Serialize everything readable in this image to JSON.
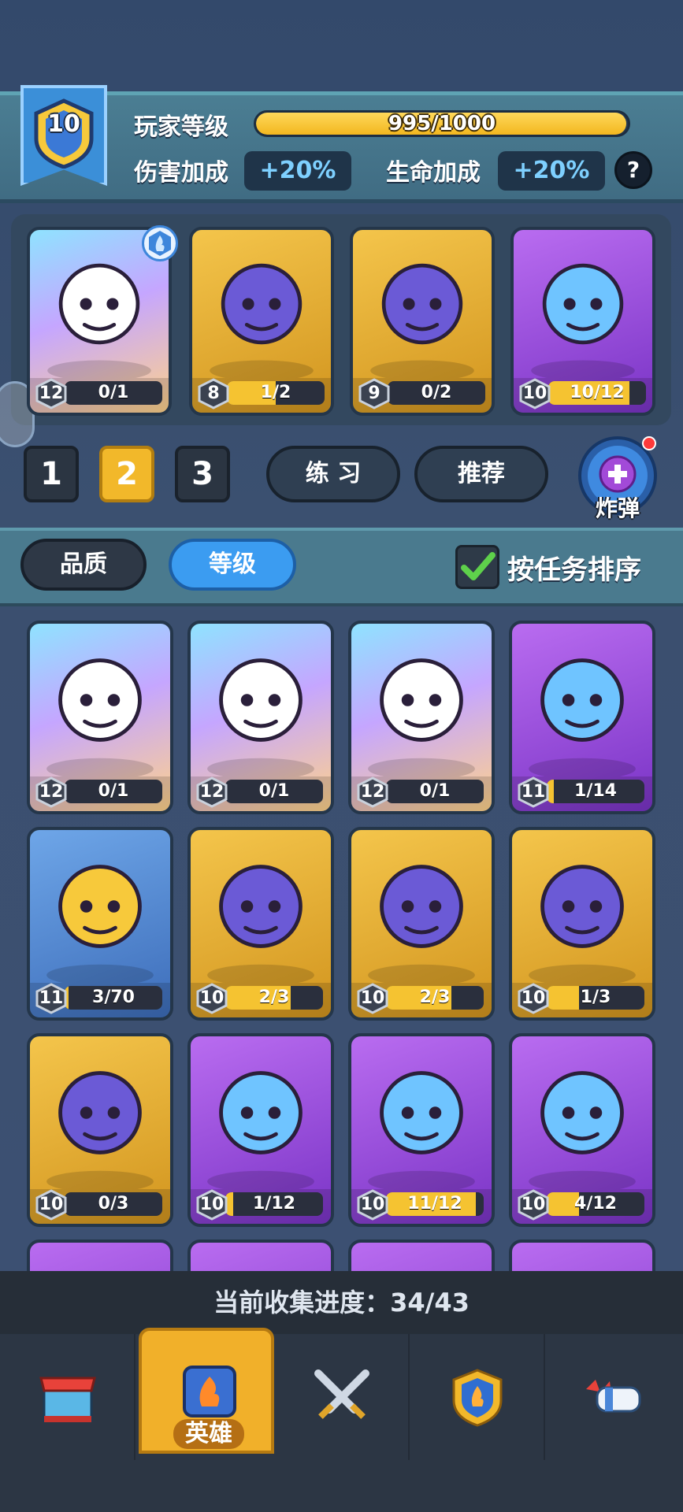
{
  "player": {
    "level": "10",
    "level_label": "玩家等级",
    "xp_text": "995/1000",
    "xp_fraction": 0.995,
    "damage_label": "伤害加成",
    "damage_value": "+20%",
    "health_label": "生命加成",
    "health_value": "+20%",
    "help": "?"
  },
  "deck": {
    "cards": [
      {
        "level": "12",
        "progress": "0/1",
        "fill": 0,
        "rarity": "legend",
        "icon": "demon-hero-icon"
      },
      {
        "level": "8",
        "progress": "1/2",
        "fill": 0.5,
        "rarity": "gold",
        "icon": "ice-golem-icon"
      },
      {
        "level": "9",
        "progress": "0/2",
        "fill": 0,
        "rarity": "gold",
        "icon": "spider-icon"
      },
      {
        "level": "10",
        "progress": "10/12",
        "fill": 0.83,
        "rarity": "purple",
        "icon": "ice-princess-icon"
      }
    ],
    "slots": [
      "1",
      "2",
      "3"
    ],
    "active_slot": "2",
    "practice": "练 习",
    "recommend": "推荐",
    "bomb": "炸弹"
  },
  "sort": {
    "quality": "品质",
    "level": "等级",
    "task_sort": "按任务排序"
  },
  "heroes": [
    {
      "level": "12",
      "progress": "0/1",
      "fill": 0,
      "rarity": "legend",
      "icon": "pirate-icon"
    },
    {
      "level": "12",
      "progress": "0/1",
      "fill": 0,
      "rarity": "legend",
      "icon": "samurai-icon"
    },
    {
      "level": "12",
      "progress": "0/1",
      "fill": 0,
      "rarity": "legend",
      "icon": "panda-icon"
    },
    {
      "level": "11",
      "progress": "1/14",
      "fill": 0.07,
      "rarity": "purple",
      "icon": "tiger-icon"
    },
    {
      "level": "11",
      "progress": "3/70",
      "fill": 0.04,
      "rarity": "blue",
      "icon": "gladiator-icon"
    },
    {
      "level": "10",
      "progress": "2/3",
      "fill": 0.67,
      "rarity": "gold",
      "icon": "knight-icon"
    },
    {
      "level": "10",
      "progress": "2/3",
      "fill": 0.67,
      "rarity": "gold",
      "icon": "masked-warrior-icon"
    },
    {
      "level": "10",
      "progress": "1/3",
      "fill": 0.33,
      "rarity": "gold",
      "icon": "fox-girl-icon"
    },
    {
      "level": "10",
      "progress": "0/3",
      "fill": 0,
      "rarity": "gold",
      "icon": "bat-icon"
    },
    {
      "level": "10",
      "progress": "1/12",
      "fill": 0.08,
      "rarity": "purple",
      "icon": "zombie-icon"
    },
    {
      "level": "10",
      "progress": "11/12",
      "fill": 0.92,
      "rarity": "purple",
      "icon": "yeti-icon"
    },
    {
      "level": "10",
      "progress": "4/12",
      "fill": 0.33,
      "rarity": "purple",
      "icon": "slime-icon"
    }
  ],
  "collection": "当前收集进度：34/43",
  "nav": {
    "shop": "shop-icon",
    "heroes_label": "英雄",
    "battle": "swords-icon",
    "rank": "crest-icon",
    "power": "fist-icon"
  },
  "colors": {
    "gold": "#f2b82a",
    "blue_accent": "#3b9cf1",
    "purple": "#9b4fe0"
  }
}
